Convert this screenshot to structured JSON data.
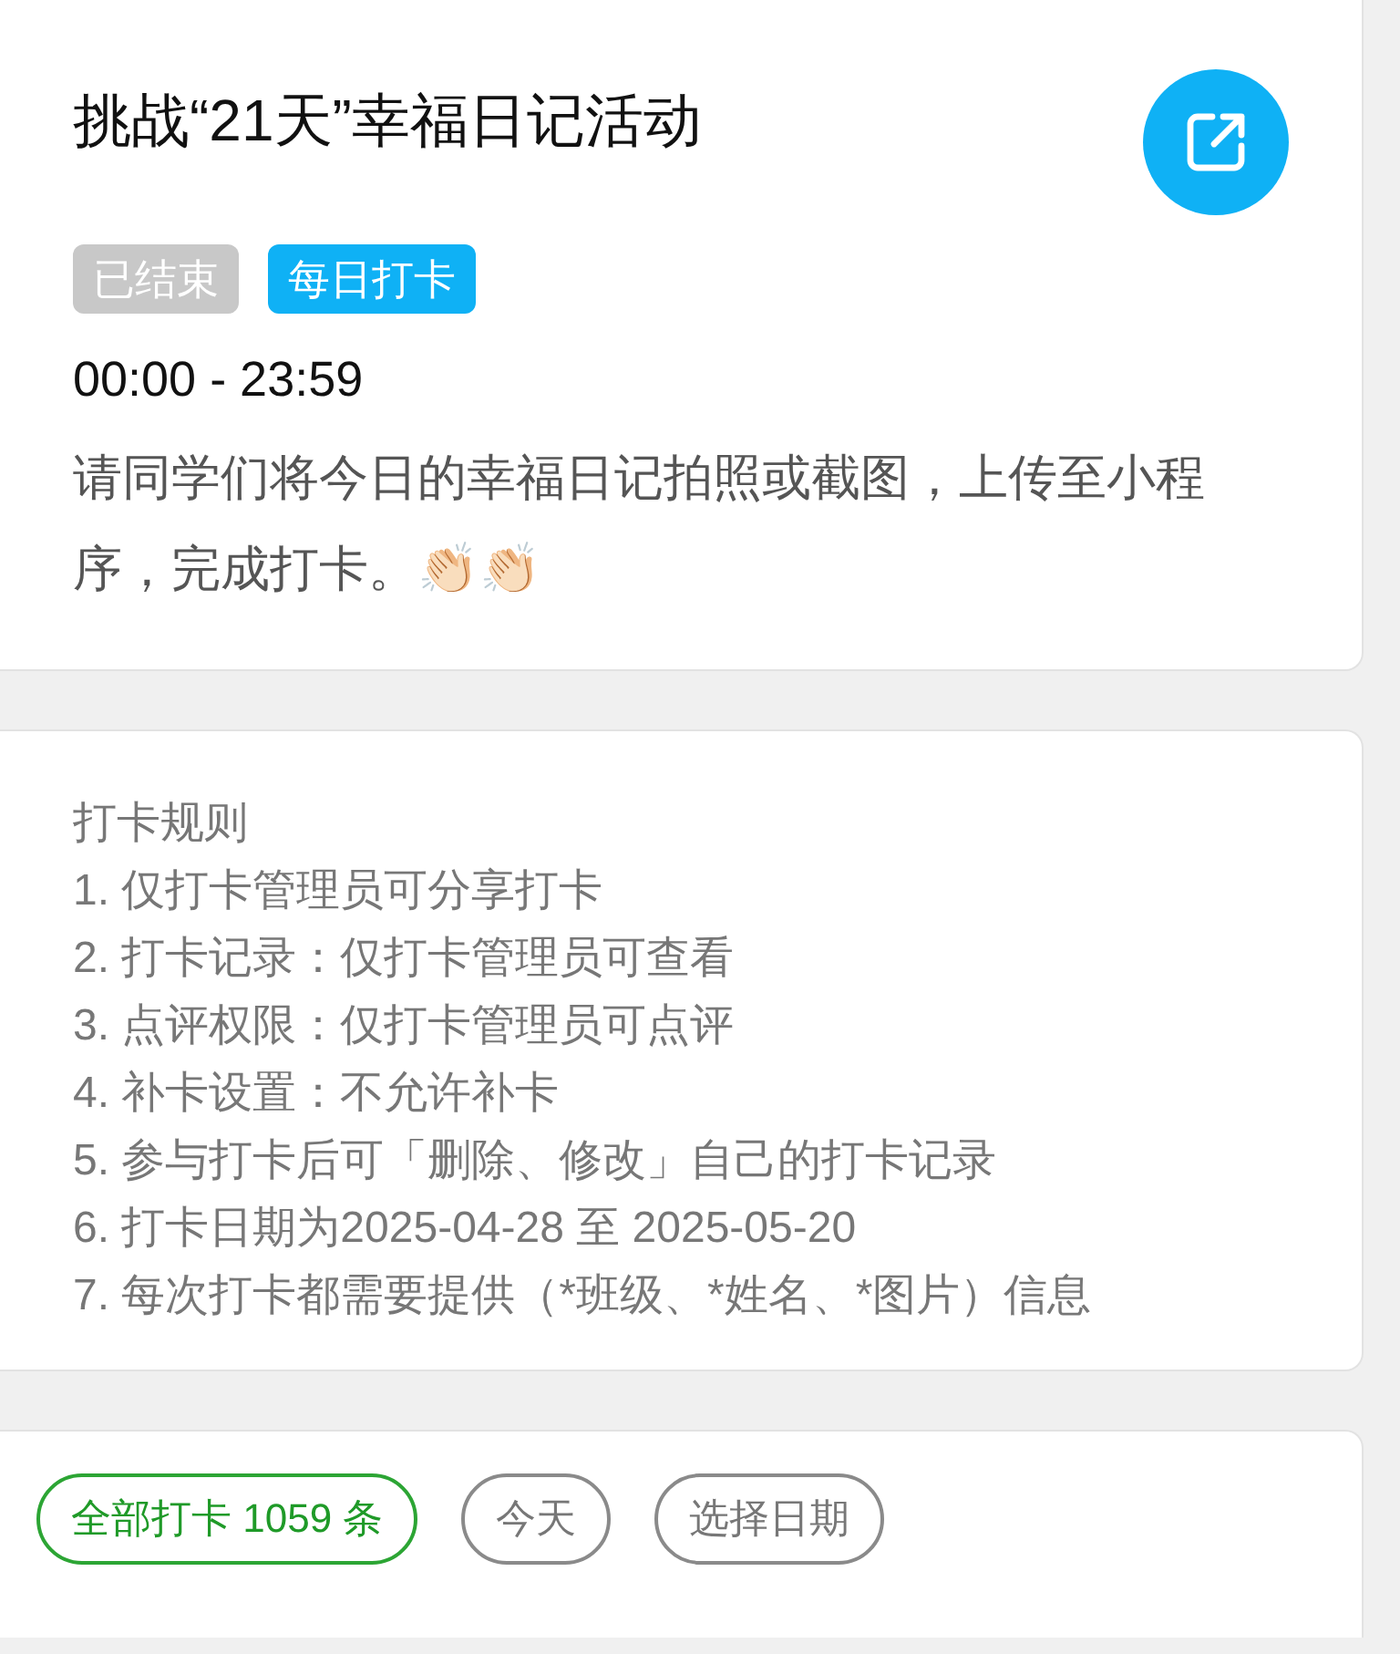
{
  "activity": {
    "title": "挑战“21天”幸福日记活动",
    "tags": [
      {
        "label": "已结束",
        "kind": "status"
      },
      {
        "label": "每日打卡",
        "kind": "type"
      }
    ],
    "time": "00:00 - 23:59",
    "description": "请同学们将今日的幸福日记拍照或截图，上传至小程序，完成打卡。👏🏻👏🏻"
  },
  "rules": {
    "heading": "打卡规则",
    "items": [
      "1. 仅打卡管理员可分享打卡",
      "2. 打卡记录：仅打卡管理员可查看",
      "3. 点评权限：仅打卡管理员可点评",
      "4. 补卡设置：不允许补卡",
      "5. 参与打卡后可「删除、修改」自己的打卡记录",
      "6. 打卡日期为2025-04-28 至 2025-05-20",
      "7. 每次打卡都需要提供（*班级、*姓名、*图片）信息"
    ]
  },
  "filters": [
    {
      "label": "全部打卡 1059 条",
      "selected": true
    },
    {
      "label": "今天",
      "selected": false
    },
    {
      "label": "选择日期",
      "selected": false
    }
  ]
}
